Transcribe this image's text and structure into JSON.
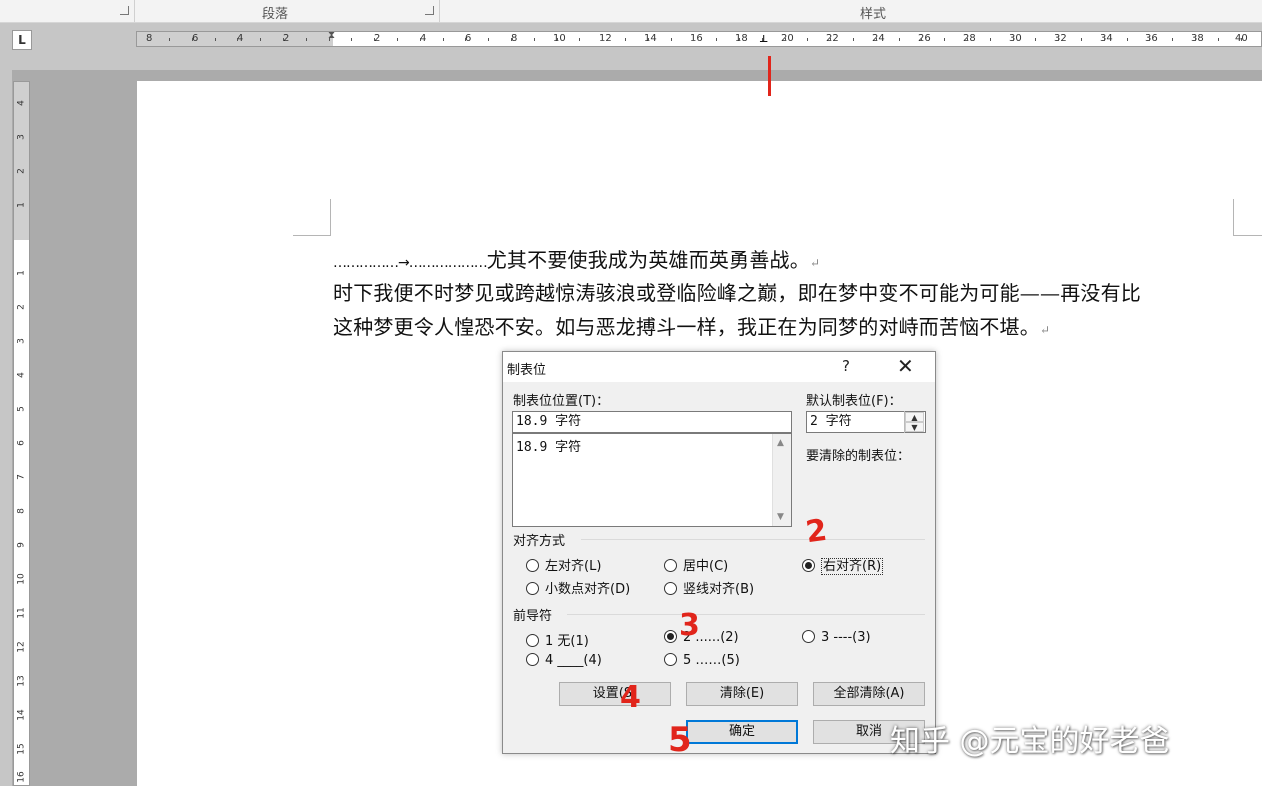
{
  "ribbon": {
    "groups": [
      {
        "label": "段落"
      },
      {
        "label": "样式"
      }
    ]
  },
  "ruler": {
    "tab_selector_glyph": "L",
    "left_numbers": [
      "8",
      "6",
      "4",
      "2"
    ],
    "right_numbers": [
      "2",
      "4",
      "6",
      "8",
      "10",
      "12",
      "14",
      "16",
      "18",
      "20",
      "22",
      "24",
      "26",
      "28",
      "30",
      "32",
      "34",
      "36",
      "38",
      "40"
    ],
    "vertical_numbers": [
      "4",
      "3",
      "2",
      "1",
      "1",
      "2",
      "3",
      "4",
      "5",
      "6",
      "7",
      "8",
      "9",
      "10",
      "11",
      "12",
      "13",
      "14",
      "15",
      "16"
    ]
  },
  "document": {
    "line1_leader": "……………→………………",
    "line1_text": "尤其不要使我成为英雄而英勇善战。",
    "line2": "时下我便不时梦见或跨越惊涛骇浪或登临险峰之巅，即在梦中变不可能为可能——再没有比",
    "line3": "这种梦更令人惶恐不安。如与恶龙搏斗一样，我正在为同梦的对峙而苦恼不堪。",
    "paragraph_mark": "↵"
  },
  "dialog": {
    "title": "制表位",
    "help_glyph": "?",
    "close_glyph": "✕",
    "tab_stop_position_label": "制表位位置(T)：",
    "tab_stop_position_value": "18.9 字符",
    "tab_stop_list": [
      "18.9 字符"
    ],
    "default_tab_stops_label": "默认制表位(F)：",
    "default_tab_stops_value": "2 字符",
    "to_be_cleared_label": "要清除的制表位：",
    "alignment_label": "对齐方式",
    "alignment_options": {
      "left": "左对齐(L)",
      "center": "居中(C)",
      "right": "右对齐(R)",
      "decimal": "小数点对齐(D)",
      "bar": "竖线对齐(B)"
    },
    "alignment_selected": "right",
    "leader_label": "前导符",
    "leader_options": {
      "l1": "1 无(1)",
      "l2": "2 ......(2)",
      "l3": "3 ----(3)",
      "l4": "4 ____(4)",
      "l5": "5 ……(5)"
    },
    "leader_selected": "l2",
    "buttons": {
      "set": "设置(S)",
      "clear": "清除(E)",
      "clear_all": "全部清除(A)",
      "ok": "确定",
      "cancel": "取消"
    }
  },
  "annotations": [
    "2",
    "3",
    "4",
    "5"
  ],
  "watermark": "知乎 @元宝的好老爸",
  "colors": {
    "annotation_red": "#e1251b",
    "dialog_default_border": "#0078d7"
  }
}
